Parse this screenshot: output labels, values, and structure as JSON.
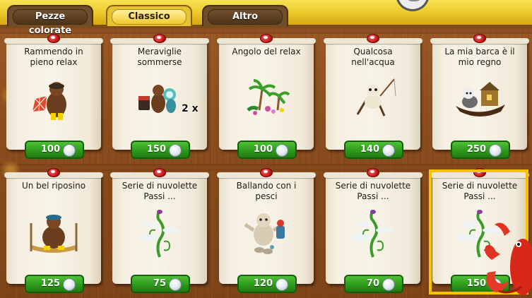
{
  "tabs": [
    {
      "label": "Pezze colorate",
      "active": false
    },
    {
      "label": "Classico",
      "active": true
    },
    {
      "label": "Altro",
      "active": false
    }
  ],
  "currency_icon": "diamond-gem-icon",
  "colors": {
    "topbar": "#ebc82a",
    "price_button": "#2e9a1c",
    "selection_border": "#f5c300",
    "pin": "#d01818"
  },
  "items": [
    {
      "title": "Rammendo in pieno relax",
      "price": "100",
      "icon": "bear-sewing-icon"
    },
    {
      "title": "Meraviglie sommerse",
      "price": "150",
      "icon": "bear-with-diver-icon",
      "quantity": "2 x"
    },
    {
      "title": "Angolo del relax",
      "price": "100",
      "icon": "palm-tree-garden-icon"
    },
    {
      "title": "Qualcosa nell'acqua",
      "price": "140",
      "icon": "sheep-fishing-icon"
    },
    {
      "title": "La mia barca è il mio regno",
      "price": "250",
      "icon": "sheep-boat-icon"
    },
    {
      "title": "Un bel riposino",
      "price": "125",
      "icon": "bear-hammock-icon"
    },
    {
      "title": "Serie di nuvolette Passi ...",
      "price": "75",
      "icon": "beanstalk-clouds-icon"
    },
    {
      "title": "Ballando con i pesci",
      "price": "120",
      "icon": "seal-dancing-icon"
    },
    {
      "title": "Serie di nuvolette Passi ...",
      "price": "70",
      "icon": "beanstalk-clouds-icon"
    },
    {
      "title": "Serie di nuvolette Passi ...",
      "price": "150",
      "icon": "beanstalk-clouds-icon",
      "selected": true
    }
  ]
}
